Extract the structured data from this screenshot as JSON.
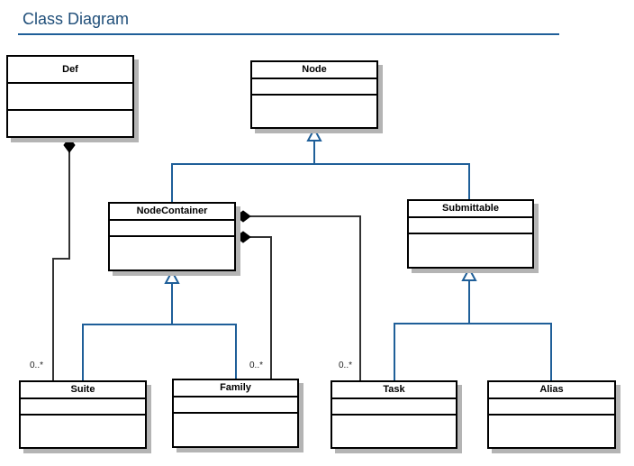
{
  "diagram": {
    "title": "Class Diagram",
    "colors": {
      "generalization": "#1f5f99",
      "composition": "#333333",
      "title": "#1f4e79"
    },
    "classes": {
      "def": {
        "name": "Def"
      },
      "node": {
        "name": "Node"
      },
      "node_container": {
        "name": "NodeContainer"
      },
      "submittable": {
        "name": "Submittable"
      },
      "suite": {
        "name": "Suite"
      },
      "family": {
        "name": "Family"
      },
      "task": {
        "name": "Task"
      },
      "alias": {
        "name": "Alias"
      }
    },
    "relations": [
      {
        "type": "generalization",
        "child": "NodeContainer",
        "parent": "Node"
      },
      {
        "type": "generalization",
        "child": "Submittable",
        "parent": "Node"
      },
      {
        "type": "generalization",
        "child": "Suite",
        "parent": "NodeContainer"
      },
      {
        "type": "generalization",
        "child": "Family",
        "parent": "NodeContainer"
      },
      {
        "type": "generalization",
        "child": "Task",
        "parent": "Submittable"
      },
      {
        "type": "generalization",
        "child": "Alias",
        "parent": "Submittable"
      },
      {
        "type": "composition",
        "whole": "Def",
        "part": "Suite",
        "multiplicity": "0..*"
      },
      {
        "type": "composition",
        "whole": "NodeContainer",
        "part": "Family",
        "multiplicity": "0..*"
      },
      {
        "type": "composition",
        "whole": "NodeContainer",
        "part": "Task",
        "multiplicity": "0..*"
      }
    ],
    "multiplicities": {
      "suite": "0..*",
      "family": "0..*",
      "task": "0..*"
    }
  }
}
